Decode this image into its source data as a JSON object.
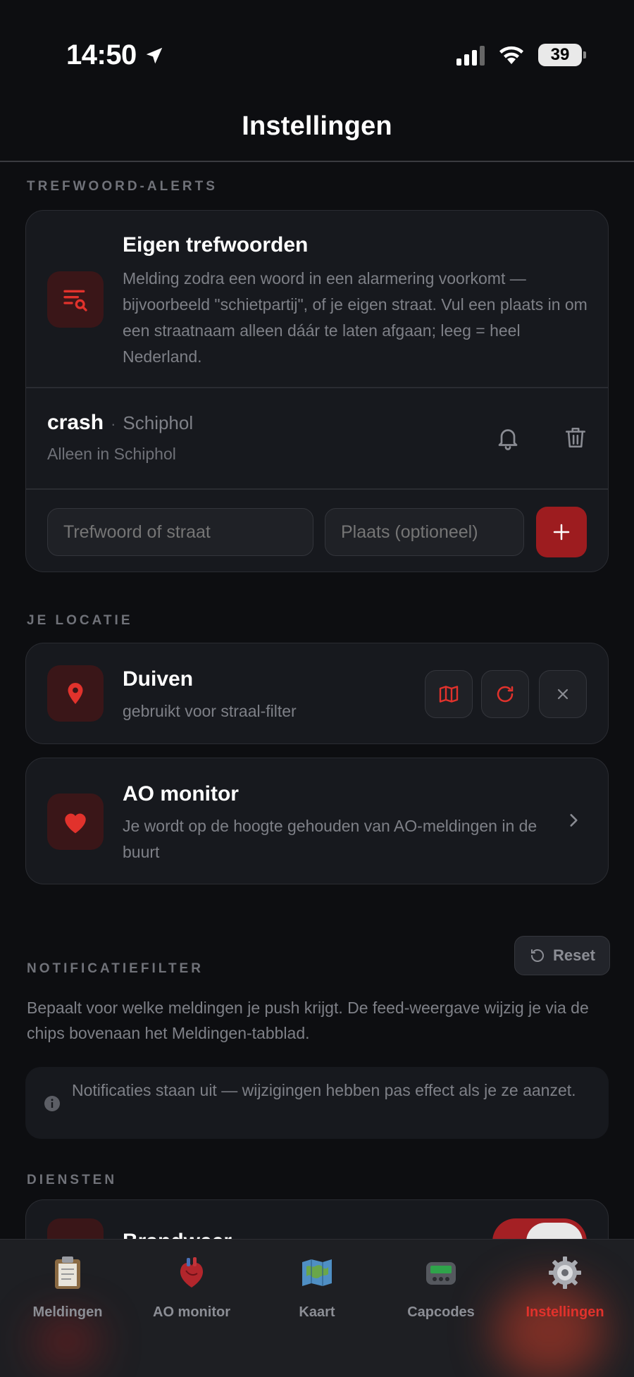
{
  "status": {
    "time": "14:50",
    "battery": "39"
  },
  "nav": {
    "title": "Instellingen"
  },
  "keywords": {
    "section_label": "TREFWOORD-ALERTS",
    "title": "Eigen trefwoorden",
    "description": "Melding zodra een woord in een alarmering voorkomt — bijvoorbeeld \"schietpartij\", of je eigen straat. Vul een plaats in om een straatnaam alleen dáár te laten afgaan; leeg = heel Nederland.",
    "item": {
      "keyword": "crash",
      "separator": "·",
      "place": "Schiphol",
      "subtitle": "Alleen in Schiphol"
    },
    "keyword_placeholder": "Trefwoord of straat",
    "place_placeholder": "Plaats (optioneel)"
  },
  "location": {
    "section_label": "JE LOCATIE",
    "title": "Duiven",
    "subtitle": "gebruikt voor straal-filter"
  },
  "ao_monitor": {
    "title": "AO monitor",
    "description": "Je wordt op de hoogte gehouden van AO-meldingen in de buurt"
  },
  "notif_filter": {
    "section_label": "NOTIFICATIEFILTER",
    "reset_label": "Reset",
    "description": "Bepaalt voor welke meldingen je push krijgt. De feed-weergave wijzig je via de chips bovenaan het Meldingen-tabblad.",
    "info": "Notificaties staan uit — wijzigingen hebben pas effect als je ze aanzet."
  },
  "services": {
    "section_label": "DIENSTEN",
    "first_item_partial": "Brandweer"
  },
  "tabs": [
    {
      "label": "Meldingen",
      "icon": "clipboard-icon"
    },
    {
      "label": "AO monitor",
      "icon": "anatomical-heart-icon"
    },
    {
      "label": "Kaart",
      "icon": "map-icon"
    },
    {
      "label": "Capcodes",
      "icon": "pager-icon"
    },
    {
      "label": "Instellingen",
      "icon": "gear-icon",
      "active": true
    }
  ],
  "colors": {
    "accent": "#e1322c",
    "accent_dark": "#9d1c1f",
    "background": "#0d0e11",
    "card": "#17191e"
  }
}
